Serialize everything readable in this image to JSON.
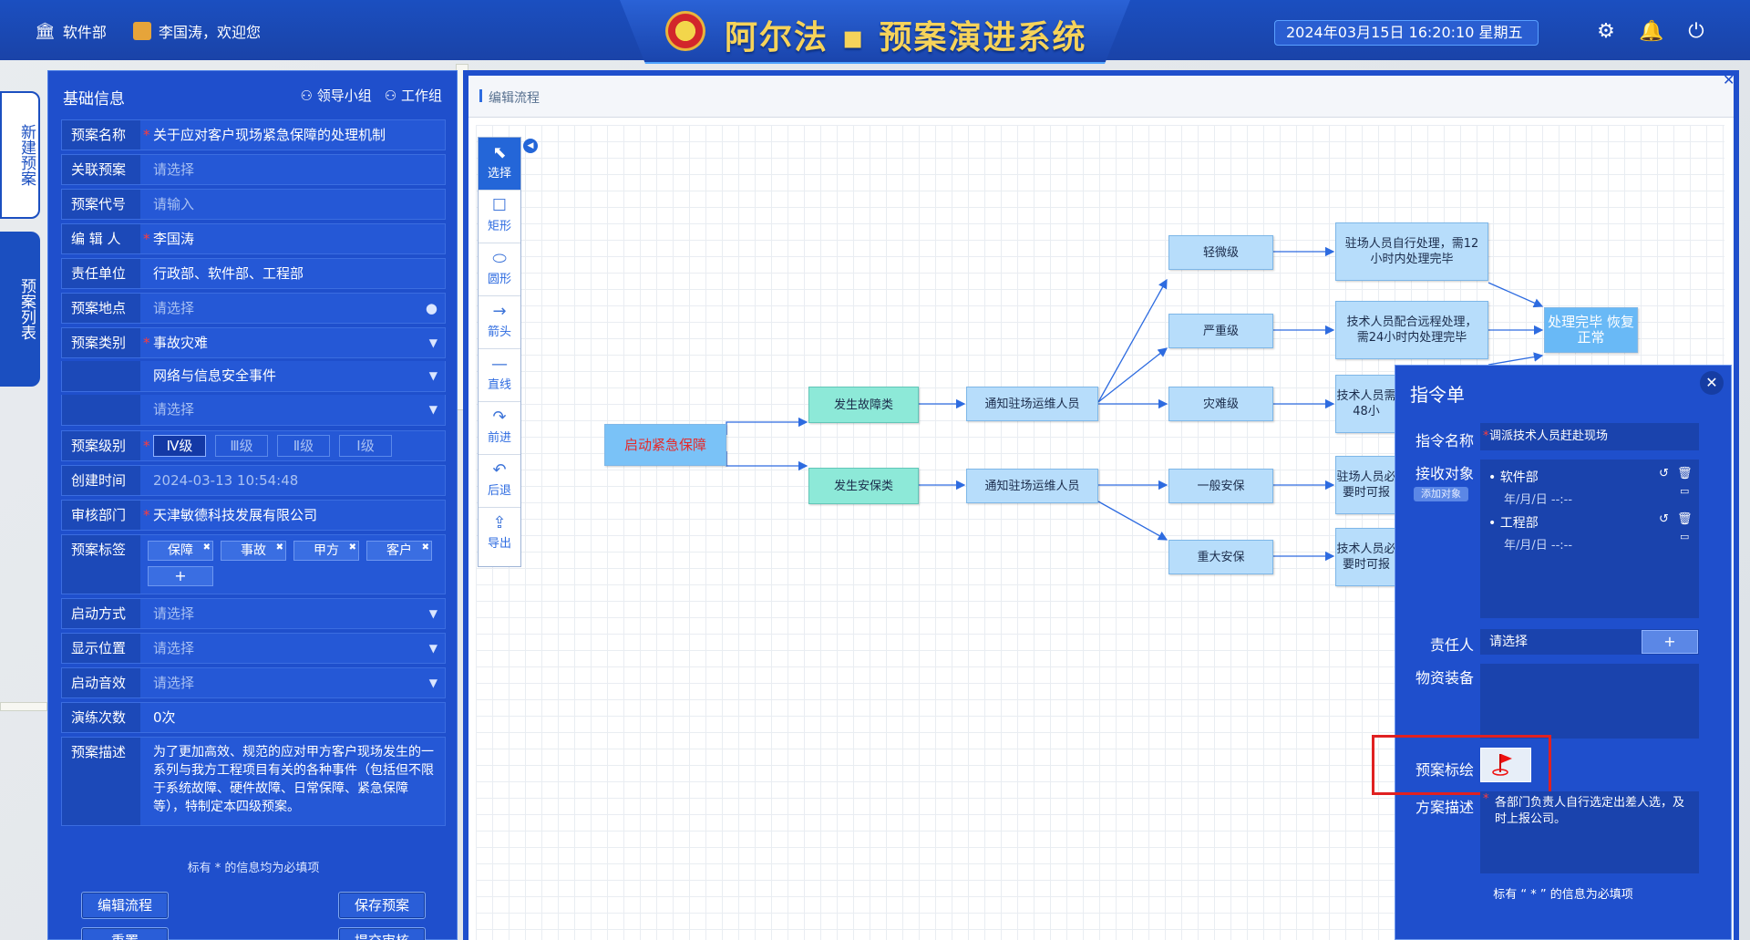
{
  "header": {
    "department": "软件部",
    "welcome": "李国涛，欢迎您",
    "title": "阿尔法 ▪ 预案演进系统",
    "datetime": "2024年03月15日 16:20:10 星期五"
  },
  "side_tabs": [
    "新建预案",
    "预案列表"
  ],
  "basic_info": {
    "title": "基础信息",
    "link_leader": "领导小组",
    "link_work": "工作组",
    "fields": {
      "name_label": "预案名称",
      "name_value": "关于应对客户现场紧急保障的处理机制",
      "related_label": "关联预案",
      "related_value": "请选择",
      "code_label": "预案代号",
      "code_value": "请输入",
      "editor_label": "编 辑 人",
      "editor_value": "李国涛",
      "unit_label": "责任单位",
      "unit_value": "行政部、软件部、工程部",
      "location_label": "预案地点",
      "location_value": "请选择",
      "category_label": "预案类别",
      "category_value": "事故灾难",
      "category_sub": "网络与信息安全事件",
      "category_sub2": "请选择",
      "level_label": "预案级别",
      "levels": [
        "Ⅳ级",
        "Ⅲ级",
        "Ⅱ级",
        "Ⅰ级"
      ],
      "created_label": "创建时间",
      "created_value": "2024-03-13 10:54:48",
      "audit_label": "审核部门",
      "audit_value": "天津敏德科技发展有限公司",
      "tags_label": "预案标签",
      "tags": [
        "保障",
        "事故",
        "甲方",
        "客户"
      ],
      "tag_add": "+",
      "start_label": "启动方式",
      "start_value": "请选择",
      "display_label": "显示位置",
      "display_value": "请选择",
      "sound_label": "启动音效",
      "sound_value": "请选择",
      "drill_label": "演练次数",
      "drill_value": "0次",
      "desc_label": "预案描述",
      "desc_value": "为了更加高效、规范的应对甲方客户现场发生的一系列与我方工程项目有关的各种事件（包括但不限于系统故障、硬件故障、日常保障、紧急保障等），特制定本四级预案。"
    },
    "required_note": "标有 * 的信息均为必填项",
    "buttons": {
      "edit_flow": "编辑流程",
      "save": "保存预案",
      "reset": "重置",
      "submit": "提交审核"
    }
  },
  "editor": {
    "title": "编辑流程",
    "tools": [
      "选择",
      "矩形",
      "圆形",
      "箭头",
      "直线",
      "前进",
      "后退",
      "导出"
    ],
    "nodes": {
      "start": "启动紧急保障",
      "fault": "发生故障类",
      "security": "发生安保类",
      "notify1": "通知驻场运维人员",
      "notify2": "通知驻场运维人员",
      "minor": "轻微级",
      "serious": "严重级",
      "disaster": "灾难级",
      "normal_sec": "一般安保",
      "major_sec": "重大安保",
      "r1": "驻场人员自行处理，需12小时内处理完毕",
      "r2": "技术人员配合远程处理，需24小时内处理完毕",
      "r3": "技术人员需48小",
      "r4": "驻场人员必要时可报",
      "r5": "技术人员必要时可报",
      "end": "处理完毕 恢复正常"
    }
  },
  "command": {
    "title": "指令单",
    "name_label": "指令名称",
    "name_value": "调派技术人员赶赴现场",
    "receiver_label": "接收对象",
    "add_receiver": "添加对象",
    "receivers": [
      {
        "name": "软件部",
        "date": "年/月/日 --:--"
      },
      {
        "name": "工程部",
        "date": "年/月/日 --:--"
      }
    ],
    "owner_label": "责任人",
    "owner_value": "请选择",
    "owner_add": "+",
    "material_label": "物资装备",
    "plot_label": "预案标绘",
    "plan_desc_label": "方案描述",
    "plan_desc_value": "各部门负责人自行选定出差人选，及时上报公司。",
    "required_note": "标有 “ * ” 的信息为必填项"
  }
}
